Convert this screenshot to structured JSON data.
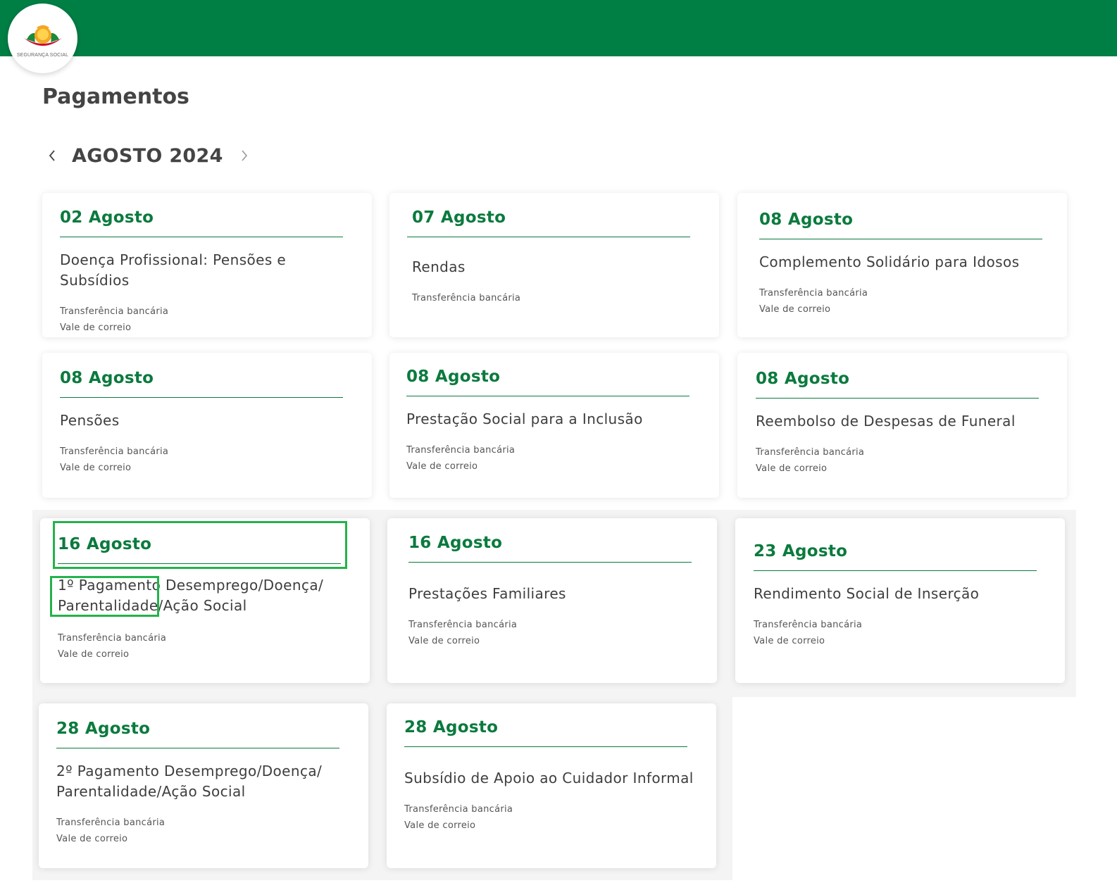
{
  "header": {
    "logo_text": "SEGURANÇA SOCIAL",
    "brand_color": "#007f45"
  },
  "page": {
    "title": "Pagamentos"
  },
  "month_nav": {
    "label": "AGOSTO 2024",
    "prev_icon": "chevron-left-icon",
    "next_icon": "chevron-right-icon"
  },
  "cards": [
    {
      "date": "02 Agosto",
      "title": "Doença Profissional: Pensões e Subsídios",
      "methods": [
        "Transferência bancária",
        "Vale de correio"
      ]
    },
    {
      "date": "07 Agosto",
      "title": "Rendas",
      "methods": [
        "Transferência bancária"
      ]
    },
    {
      "date": "08 Agosto",
      "title": "Complemento Solidário para Idosos",
      "methods": [
        "Transferência bancária",
        "Vale de correio"
      ]
    },
    {
      "date": "08 Agosto",
      "title": "Pensões",
      "methods": [
        "Transferência bancária",
        "Vale de correio"
      ]
    },
    {
      "date": "08 Agosto",
      "title": "Prestação Social para a Inclusão",
      "methods": [
        "Transferência bancária",
        "Vale de correio"
      ]
    },
    {
      "date": "08 Agosto",
      "title": "Reembolso de Despesas de Funeral",
      "methods": [
        "Transferência bancária",
        "Vale de correio"
      ]
    },
    {
      "date": "16 Agosto",
      "title": "1º Pagamento Desemprego/Doença/ Parentalidade/Ação Social",
      "methods": [
        "Transferência bancária",
        "Vale de correio"
      ]
    },
    {
      "date": "16 Agosto",
      "title": "Prestações Familiares",
      "methods": [
        "Transferência bancária",
        "Vale de correio"
      ]
    },
    {
      "date": "23 Agosto",
      "title": "Rendimento Social de Inserção",
      "methods": [
        "Transferência bancária",
        "Vale de correio"
      ]
    },
    {
      "date": "28 Agosto",
      "title": "2º Pagamento Desemprego/Doença/ Parentalidade/Ação Social",
      "methods": [
        "Transferência bancária",
        "Vale de correio"
      ]
    },
    {
      "date": "28 Agosto",
      "title": "Subsídio de Apoio ao Cuidador Informal",
      "methods": [
        "Transferência bancária",
        "Vale de correio"
      ]
    }
  ],
  "colors": {
    "date_green": "#0b7a3e",
    "highlight": "#24b24b"
  }
}
